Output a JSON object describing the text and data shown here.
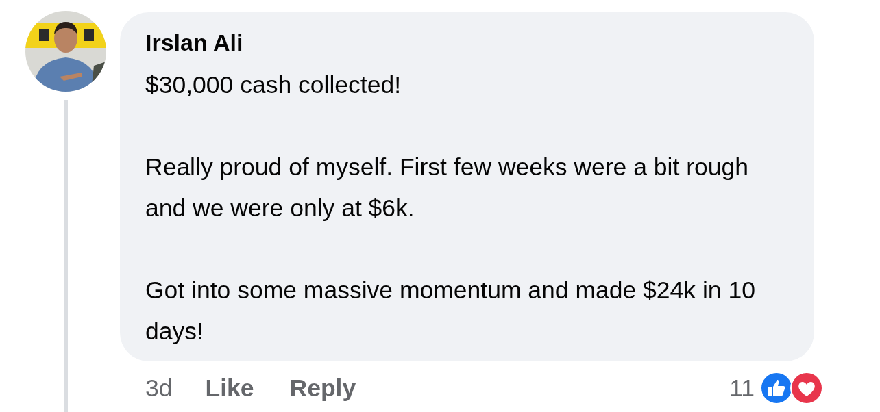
{
  "comment": {
    "author": "Irslan Ali",
    "paragraphs": [
      "$30,000 cash collected!",
      "Really proud of myself. First few weeks were a bit rough and we were only at $6k.",
      "Got into some massive momentum and made $24k in 10 days!"
    ],
    "time": "3d",
    "actions": [
      "Like",
      "Reply"
    ],
    "reaction_count": "11",
    "reactions": [
      {
        "kind": "like"
      },
      {
        "kind": "love"
      }
    ]
  }
}
